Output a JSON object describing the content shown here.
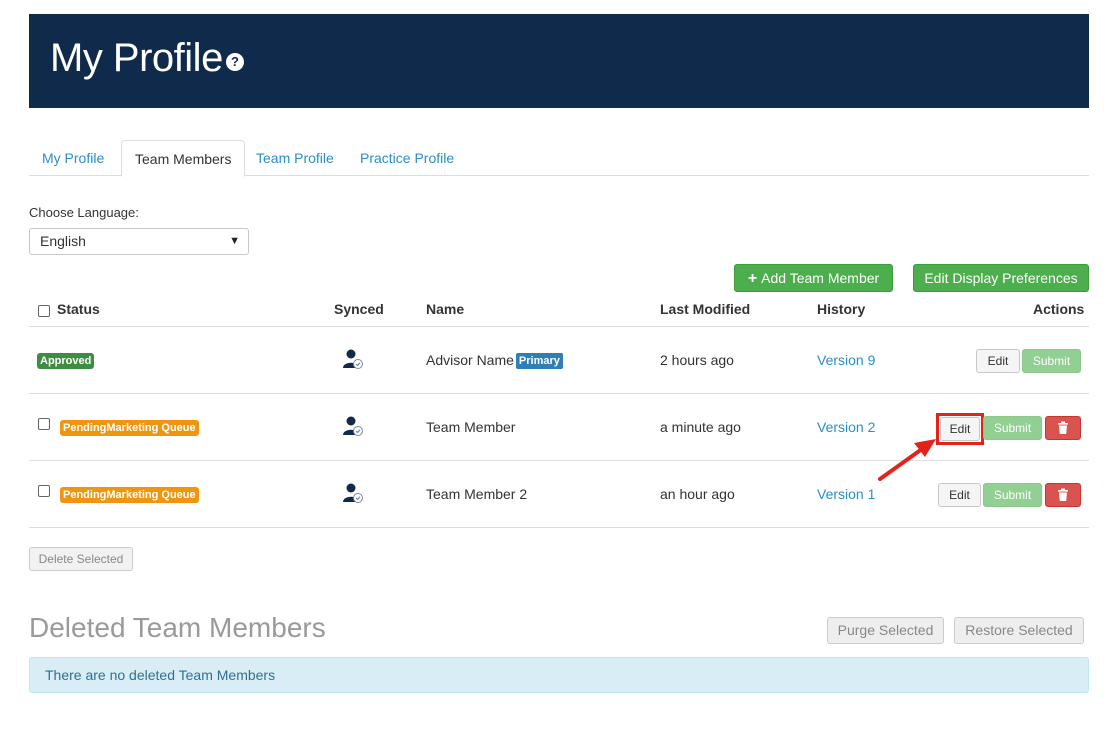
{
  "header": {
    "title": "My Profile",
    "help_glyph": "?"
  },
  "tabs": [
    {
      "label": "My Profile",
      "active": false
    },
    {
      "label": "Team Members",
      "active": true
    },
    {
      "label": "Team Profile",
      "active": false
    },
    {
      "label": "Practice Profile",
      "active": false
    }
  ],
  "language": {
    "label": "Choose Language:",
    "selected": "English"
  },
  "toolbar": {
    "add_label": "Add Team Member",
    "prefs_label": "Edit Display Preferences"
  },
  "table": {
    "headers": {
      "status": "Status",
      "synced": "Synced",
      "name": "Name",
      "modified": "Last Modified",
      "history": "History",
      "actions": "Actions"
    },
    "rows": [
      {
        "status": "Approved",
        "status_color": "#3e8e41",
        "name": "Advisor Name",
        "tag": "Primary",
        "modified": "2 hours ago",
        "history": "Version 9",
        "edit": "Edit",
        "submit": "Submit"
      },
      {
        "status": "PendingMarketing Queue",
        "status_color": "#f0950f",
        "name": "Team Member",
        "modified": "a minute ago",
        "history": "Version 2",
        "edit": "Edit",
        "submit": "Submit"
      },
      {
        "status": "PendingMarketing Queue",
        "status_color": "#f0950f",
        "name": "Team Member 2",
        "modified": "an hour ago",
        "history": "Version 1",
        "edit": "Edit",
        "submit": "Submit"
      }
    ]
  },
  "delete_selected": "Delete Selected",
  "deleted": {
    "title": "Deleted Team Members",
    "purge_label": "Purge Selected",
    "restore_label": "Restore Selected",
    "empty_message": "There are no deleted Team Members"
  },
  "icons": {
    "help": "question-circle-icon",
    "synced": "user-check-icon",
    "delete": "trash-icon",
    "add": "plus-icon",
    "annotation": "red-arrow-icon"
  },
  "colors": {
    "header_bg": "#102a4c",
    "link": "#2a8fc7",
    "primary_green": "#4cae4c",
    "danger": "#d9534f",
    "annotation": "#e2231a"
  }
}
